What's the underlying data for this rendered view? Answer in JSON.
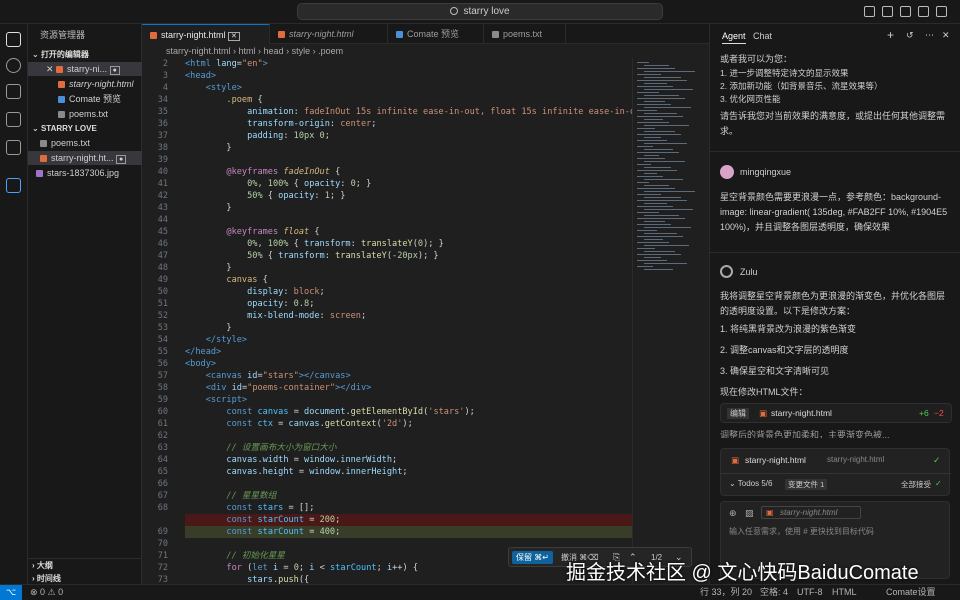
{
  "titlebar": {
    "search": "starry love"
  },
  "sidebar": {
    "title": "资源管理器",
    "open_editors": "打开的编辑器",
    "open_files": [
      "starry-ni...",
      "starry-night.html",
      "Comate 预览",
      "poems.txt"
    ],
    "project": "STARRY LOVE",
    "project_files": [
      "poems.txt",
      "starry-night.ht...",
      "stars-1837306.jpg"
    ],
    "outline": "大纲",
    "timeline": "时间线"
  },
  "tabs": [
    "starry-night.html",
    "starry-night.html",
    "Comate 预览",
    "poems.txt"
  ],
  "breadcrumb": {
    "file": "starry-night.html",
    "p1": "html",
    "p2": "head",
    "p3": "style",
    "p4": ".poem"
  },
  "code_lines": [
    {
      "n": "2",
      "html": "<span class='k'>&lt;html</span> <span class='p'>lang</span>=<span class='s'>\"en\"</span><span class='k'>&gt;</span>"
    },
    {
      "n": "3",
      "html": "<span class='k'>&lt;head&gt;</span>"
    },
    {
      "n": "4",
      "html": "    <span class='k'>&lt;style&gt;</span>"
    },
    {
      "n": "34",
      "html": "        <span class='y'>.poem</span> {"
    },
    {
      "n": "35",
      "html": "            <span class='p'>animation</span>: <span class='s'>fadeInOut 15s infinite ease-in-out, float 15s infinite ease-in-out</span>;"
    },
    {
      "n": "36",
      "html": "            <span class='p'>transform-origin</span>: <span class='s'>center</span>;"
    },
    {
      "n": "37",
      "html": "            <span class='p'>padding</span>: <span class='n'>10px 0</span>;"
    },
    {
      "n": "38",
      "html": "        }"
    },
    {
      "n": "39",
      "html": ""
    },
    {
      "n": "40",
      "html": "        <span class='kw'>@keyframes</span> <span class='y'><i>fadeInOut</i></span> {"
    },
    {
      "n": "41",
      "html": "            <span class='n'>0%, 100%</span> { <span class='p'>opacity</span>: <span class='n'>0</span>; }"
    },
    {
      "n": "42",
      "html": "            <span class='n'>50%</span> { <span class='p'>opacity</span>: <span class='n'>1</span>; }"
    },
    {
      "n": "43",
      "html": "        }"
    },
    {
      "n": "44",
      "html": ""
    },
    {
      "n": "45",
      "html": "        <span class='kw'>@keyframes</span> <span class='y'><i>float</i></span> {"
    },
    {
      "n": "46",
      "html": "            <span class='n'>0%, 100%</span> { <span class='p'>transform</span>: <span class='f'>translateY</span>(<span class='n'>0</span>); }"
    },
    {
      "n": "47",
      "html": "            <span class='n'>50%</span> { <span class='p'>transform</span>: <span class='f'>translateY</span>(<span class='n'>-20px</span>); }"
    },
    {
      "n": "48",
      "html": "        }"
    },
    {
      "n": "49",
      "html": "        <span class='y'>canvas</span> {"
    },
    {
      "n": "50",
      "html": "            <span class='p'>display</span>: <span class='s'>block</span>;"
    },
    {
      "n": "51",
      "html": "            <span class='p'>opacity</span>: <span class='n'>0.8</span>;"
    },
    {
      "n": "52",
      "html": "            <span class='p'>mix-blend-mode</span>: <span class='s'>screen</span>;"
    },
    {
      "n": "53",
      "html": "        }"
    },
    {
      "n": "54",
      "html": "    <span class='k'>&lt;/style&gt;</span>"
    },
    {
      "n": "55",
      "html": "<span class='k'>&lt;/head&gt;</span>"
    },
    {
      "n": "56",
      "html": "<span class='k'>&lt;body&gt;</span>"
    },
    {
      "n": "57",
      "html": "    <span class='k'>&lt;canvas</span> <span class='p'>id</span>=<span class='s'>\"stars\"</span><span class='k'>&gt;&lt;/canvas&gt;</span>"
    },
    {
      "n": "58",
      "html": "    <span class='k'>&lt;div</span> <span class='p'>id</span>=<span class='s'>\"poems-container\"</span><span class='k'>&gt;&lt;/div&gt;</span>"
    },
    {
      "n": "59",
      "html": "    <span class='k'>&lt;script&gt;</span>"
    },
    {
      "n": "60",
      "html": "        <span class='k'>const</span> <span class='v'>canvas</span> = <span class='p'>document</span>.<span class='f'>getElementById</span>(<span class='s'>'stars'</span>);"
    },
    {
      "n": "61",
      "html": "        <span class='k'>const</span> <span class='v'>ctx</span> = <span class='p'>canvas</span>.<span class='f'>getContext</span>(<span class='s'>'2d'</span>);"
    },
    {
      "n": "62",
      "html": ""
    },
    {
      "n": "63",
      "html": "        <span class='c'>// 设置画布大小为窗口大小</span>"
    },
    {
      "n": "64",
      "html": "        <span class='p'>canvas</span>.<span class='p'>width</span> = <span class='p'>window</span>.<span class='p'>innerWidth</span>;"
    },
    {
      "n": "65",
      "html": "        <span class='p'>canvas</span>.<span class='p'>height</span> = <span class='p'>window</span>.<span class='p'>innerHeight</span>;"
    },
    {
      "n": "66",
      "html": ""
    },
    {
      "n": "67",
      "html": "        <span class='c'>// 星星数组</span>"
    },
    {
      "n": "68",
      "html": "        <span class='k'>const</span> <span class='v'>stars</span> = [];"
    },
    {
      "n": "",
      "html": "        <span class='k'>const</span> <span class='v'>starCount</span> = <span class='n'>200</span>;"
    },
    {
      "n": "69",
      "html": "        <span class='k'>const</span> <span class='v'>starCount</span> = <span class='n'>400</span>;"
    },
    {
      "n": "70",
      "html": ""
    },
    {
      "n": "71",
      "html": "        <span class='c'>// 初始化星星</span>"
    },
    {
      "n": "72",
      "html": "        <span class='kw'>for</span> (<span class='k'>let</span> <span class='p'>i</span> = <span class='n'>0</span>; <span class='p'>i</span> &lt; <span class='v'>starCount</span>; <span class='p'>i</span>++) {"
    },
    {
      "n": "73",
      "html": "            <span class='p'>stars</span>.<span class='f'>push</span>({"
    }
  ],
  "findbar": {
    "keep": "保留 ⌘↵",
    "undo": "撤消 ⌘⌫",
    "count": "1/2"
  },
  "panel": {
    "tab_agent": "Agent",
    "tab_chat": "Chat",
    "intro": "或者我可以为您：",
    "options": [
      "1. 进一步调整特定诗文的显示效果",
      "2. 添加新功能（如背景音乐、流星效果等）",
      "3. 优化网页性能"
    ],
    "question": "请告诉我您对当前效果的满意度，或提出任何其他调整需求。",
    "user": "mingqingxue",
    "user_msg": "星空背景颜色需要更浪漫一点，参考颜色：background-image: linear-gradient( 135deg, #FAB2FF 10%, #1904E5 100%)，并且调整各图层透明度，确保效果",
    "bot": "Zulu",
    "bot_msg": "我将调整星空背景颜色为更浪漫的渐变色，并优化各图层的透明度设置。以下是修改方案：",
    "plan": [
      "1. 将纯黑背景改为浪漫的紫色渐变",
      "2. 调整canvas和文字层的透明度",
      "3. 确保星空和文字清晰可见"
    ],
    "now": "现在修改HTML文件：",
    "edit_label": "编辑",
    "edit_file": "starry-night.html",
    "add": "+6",
    "del": "−2",
    "cut_text": "调整后的背景色更加柔和，主要渐变色被...",
    "change_file": "starry-night.html",
    "change_path": "starry-night.html",
    "todos": "Todos 5/6",
    "changed": "变更文件 1",
    "accept_all": "全部接受",
    "ctx_file": "starry-night.html",
    "input_placeholder": "输入任意需求，使用 # 更快找到目标代码"
  },
  "statusbar": {
    "left": "⊗ 0  ⚠ 0",
    "pos": "行 33，列 20",
    "spaces": "空格: 4",
    "enc": "UTF-8",
    "lang": "HTML",
    "comate": "Comate设置"
  },
  "watermark": "掘金技术社区 @ 文心快码BaiduComate"
}
